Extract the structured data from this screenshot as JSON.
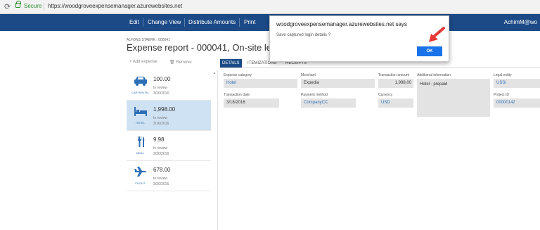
{
  "browser": {
    "secure_label": "Secure",
    "url": "https://woodgroveexpensemanager.azurewebsites.net"
  },
  "toolbar": {
    "edit": "Edit",
    "change_view": "Change View",
    "distribute": "Distribute Amounts",
    "print": "Print",
    "user": "AchimM@wo"
  },
  "header": {
    "breadcrumb": "ALFONS STAERK : 000041",
    "title": "Expense report - 000041, On-site lea",
    "add_expense": "+ Add expense",
    "remove": "🗑 Remove"
  },
  "expenses": [
    {
      "amount": "100.00",
      "status": "In review",
      "date": "3/20/2016",
      "category": "CAR RENTAL",
      "icon": "car-icon"
    },
    {
      "amount": "1,998.00",
      "status": "In review",
      "date": "3/16/2016",
      "category": "HOTEL",
      "icon": "bed-icon"
    },
    {
      "amount": "9.98",
      "status": "In review",
      "date": "3/20/2016",
      "category": "MEAL",
      "icon": "fork-knife-icon"
    },
    {
      "amount": "678.00",
      "status": "In review",
      "date": "3/20/2016",
      "category": "FLIGHT",
      "icon": "airplane-icon"
    }
  ],
  "tabs": [
    "DETAILS",
    "ITEMIZATIONS",
    "RECEIPTS"
  ],
  "fields": {
    "expense_category": {
      "label": "Expense category",
      "value": "Hotel"
    },
    "merchant": {
      "label": "Merchant",
      "value": "Expedia"
    },
    "transaction_amount": {
      "label": "Transaction amount",
      "value": "1,998.00"
    },
    "additional_info": {
      "label": "Additional information",
      "value": "Hotel - prepaid"
    },
    "legal_entity": {
      "label": "Legal entity",
      "value": "USSI"
    },
    "transaction_date": {
      "label": "Transaction date",
      "value": "3/18/2016"
    },
    "payment_method": {
      "label": "Payment method",
      "value": "CompanyCC"
    },
    "currency": {
      "label": "Currency",
      "value": "USD"
    },
    "project_id": {
      "label": "Project ID",
      "value": "00000142"
    }
  },
  "dialog": {
    "title": "woodgroveexpensemanager.azurewebsites.net says",
    "message": "Save captured login details ?",
    "ok": "OK"
  },
  "colors": {
    "app_bar": "#1c4a86",
    "selected_row": "#cfe2f3",
    "link": "#2d6fb6",
    "ok_button": "#1a73e8",
    "arrow": "#e53935"
  }
}
